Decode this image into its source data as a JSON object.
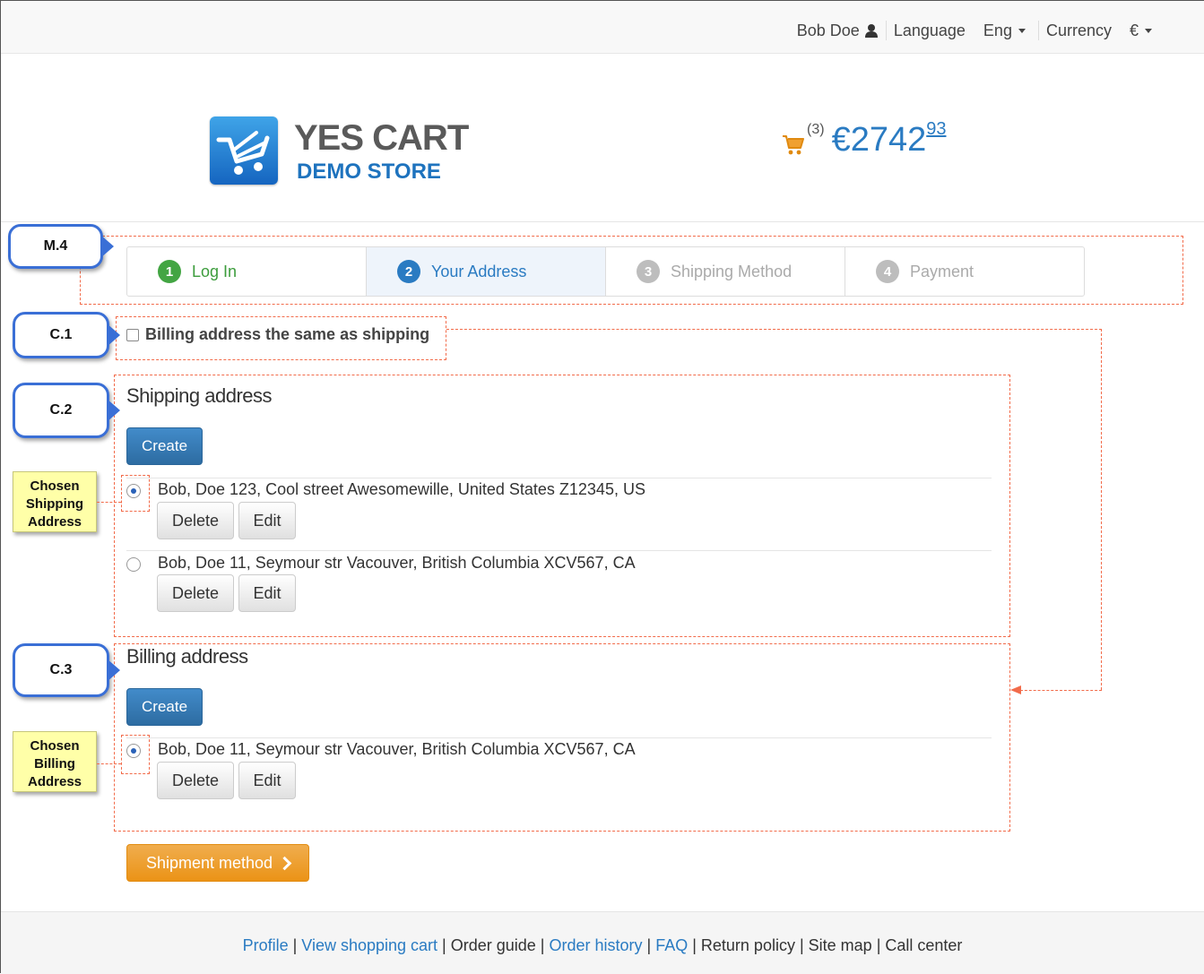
{
  "header": {
    "user_name": "Bob Doe",
    "language_label": "Language",
    "language_value": "Eng",
    "currency_label": "Currency",
    "currency_value": "€"
  },
  "brand": {
    "line1": "YES CART",
    "line2": "DEMO STORE"
  },
  "cart": {
    "count": "(3)",
    "total_main": "€2742",
    "total_cents": "93",
    "icon": "shopping-cart-icon",
    "color": "#2a7bc2"
  },
  "steps": [
    {
      "num": "1",
      "label": "Log In",
      "state": "done"
    },
    {
      "num": "2",
      "label": "Your Address",
      "state": "active"
    },
    {
      "num": "3",
      "label": "Shipping Method",
      "state": "todo"
    },
    {
      "num": "4",
      "label": "Payment",
      "state": "todo"
    }
  ],
  "callouts": {
    "m4": "M.4",
    "c1": "C.1",
    "c2": "C.2",
    "c3": "C.3"
  },
  "notes": {
    "shipping": [
      "Chosen",
      "Shipping",
      "Address"
    ],
    "billing": [
      "Chosen",
      "Billing",
      "Address"
    ]
  },
  "billing_same": {
    "label": "Billing address the same as shipping",
    "checked": false
  },
  "shipping": {
    "title": "Shipping address",
    "create_label": "Create",
    "addresses": [
      {
        "text": "Bob, Doe 123, Cool street Awesomewille, United States Z12345, US",
        "selected": true
      },
      {
        "text": "Bob, Doe 11, Seymour str Vacouver, British Columbia XCV567, CA",
        "selected": false
      }
    ]
  },
  "billing": {
    "title": "Billing address",
    "create_label": "Create",
    "addresses": [
      {
        "text": "Bob, Doe 11, Seymour str Vacouver, British Columbia XCV567, CA",
        "selected": true
      }
    ]
  },
  "actions": {
    "delete_label": "Delete",
    "edit_label": "Edit",
    "next_label": "Shipment method"
  },
  "footer": {
    "links": [
      {
        "label": "Profile",
        "link": true
      },
      {
        "label": "View shopping cart",
        "link": true
      },
      {
        "label": "Order guide",
        "link": false
      },
      {
        "label": "Order history",
        "link": true
      },
      {
        "label": "FAQ",
        "link": true
      },
      {
        "label": "Return policy",
        "link": false
      },
      {
        "label": "Site map",
        "link": false
      },
      {
        "label": "Call center",
        "link": false
      }
    ],
    "separator": "|"
  },
  "colors": {
    "primary": "#2a7bc2",
    "success": "#43a543",
    "warning": "#f0ad4e",
    "annotation": "#f26b4a",
    "callout_border": "#3a6fd6"
  }
}
